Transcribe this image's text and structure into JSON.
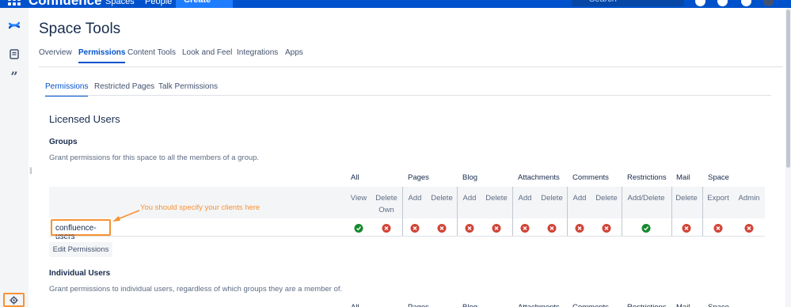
{
  "topnav": {
    "app_name": "Confluence",
    "links": [
      "Spaces",
      "People"
    ],
    "create_label": "Create",
    "search_placeholder": "Search"
  },
  "page": {
    "title": "Space Tools",
    "tabs": [
      "Overview",
      "Permissions",
      "Content Tools",
      "Look and Feel",
      "Integrations",
      "Apps"
    ],
    "active_tab": "Permissions"
  },
  "subtabs": {
    "items": [
      "Permissions",
      "Restricted Pages",
      "Talk Permissions"
    ],
    "active": "Permissions"
  },
  "licensed": {
    "title": "Licensed Users",
    "groups_heading": "Groups",
    "groups_desc": "Grant permissions for this space to all the members of a group.",
    "categories": [
      "All",
      "Pages",
      "Blog",
      "Attachments",
      "Comments",
      "Restrictions",
      "Mail",
      "Space"
    ],
    "columns": [
      "View",
      "Delete Own",
      "Add",
      "Delete",
      "Add",
      "Delete",
      "Add",
      "Delete",
      "Add",
      "Delete",
      "Add/Delete",
      "Delete",
      "Export",
      "Admin"
    ],
    "rows": [
      {
        "group": "confluence-users",
        "permissions": [
          true,
          false,
          false,
          false,
          false,
          false,
          false,
          false,
          false,
          false,
          true,
          false,
          false,
          false
        ]
      }
    ],
    "annotation": "You should specify your clients here",
    "edit_button": "Edit Permissions"
  },
  "individual": {
    "heading": "Individual Users",
    "desc": "Grant permissions to individual users, regardless of which groups they are a member of."
  },
  "colors": {
    "brand": "#0052cc",
    "granted": "#14892c",
    "denied": "#d04437",
    "highlight": "#f79232"
  }
}
